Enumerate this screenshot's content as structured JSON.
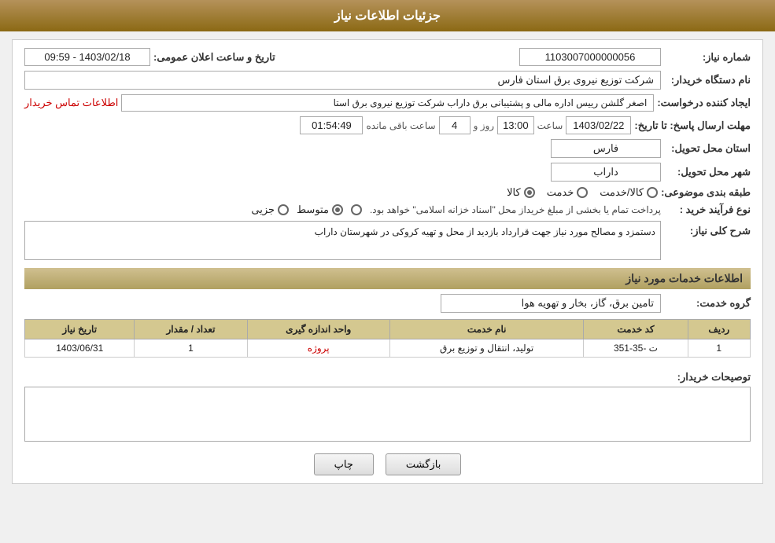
{
  "header": {
    "title": "جزئیات اطلاعات نیاز"
  },
  "fields": {
    "need_number_label": "شماره نیاز:",
    "need_number_value": "1103007000000056",
    "announce_datetime_label": "تاریخ و ساعت اعلان عمومی:",
    "announce_datetime_value": "1403/02/18 - 09:59",
    "buyer_org_label": "نام دستگاه خریدار:",
    "buyer_org_value": "شرکت توزیع نیروی برق استان فارس",
    "creator_label": "ایجاد کننده درخواست:",
    "creator_value": "اصغر گلشن رییس اداره مالی و پشتیبانی برق داراب شرکت توزیع نیروی برق استا",
    "contact_link": "اطلاعات تماس خریدار",
    "deadline_label": "مهلت ارسال پاسخ: تا تاریخ:",
    "deadline_date": "1403/02/22",
    "deadline_time_label": "ساعت",
    "deadline_time": "13:00",
    "deadline_days_label": "روز و",
    "deadline_days": "4",
    "remaining_label": "ساعت باقی مانده",
    "remaining_time": "01:54:49",
    "province_label": "استان محل تحویل:",
    "province_value": "فارس",
    "city_label": "شهر محل تحویل:",
    "city_value": "داراب",
    "category_label": "طبقه بندی موضوعی:",
    "category_options": [
      "کالا",
      "خدمت",
      "کالا/خدمت"
    ],
    "category_selected": "کالا",
    "purchase_type_label": "نوع فرآیند خرید :",
    "purchase_types": [
      "جزیی",
      "متوسط",
      "پرداخت تمام یا بخشی از مبلغ خریداز محل \"اسناد خزانه اسلامی\" خواهد بود."
    ],
    "purchase_selected": "متوسط",
    "description_label": "شرح کلی نیاز:",
    "description_value": "دستمزد و مصالح مورد نیاز جهت قرارداد بازدید از محل و تهیه کروکی در شهرستان داراب",
    "services_section_title": "اطلاعات خدمات مورد نیاز",
    "service_group_label": "گروه خدمت:",
    "service_group_value": "تامین برق، گاز، بخار و تهویه هوا"
  },
  "table": {
    "headers": [
      "ردیف",
      "کد خدمت",
      "نام خدمت",
      "واحد اندازه گیری",
      "تعداد / مقدار",
      "تاریخ نیاز"
    ],
    "rows": [
      {
        "row_num": "1",
        "code": "ت -35-351",
        "name": "تولید، انتقال و توزیع برق",
        "unit": "پروژه",
        "quantity": "1",
        "date": "1403/06/31"
      }
    ]
  },
  "buyer_desc_label": "توصیحات خریدار:",
  "buttons": {
    "back": "بازگشت",
    "print": "چاپ"
  }
}
